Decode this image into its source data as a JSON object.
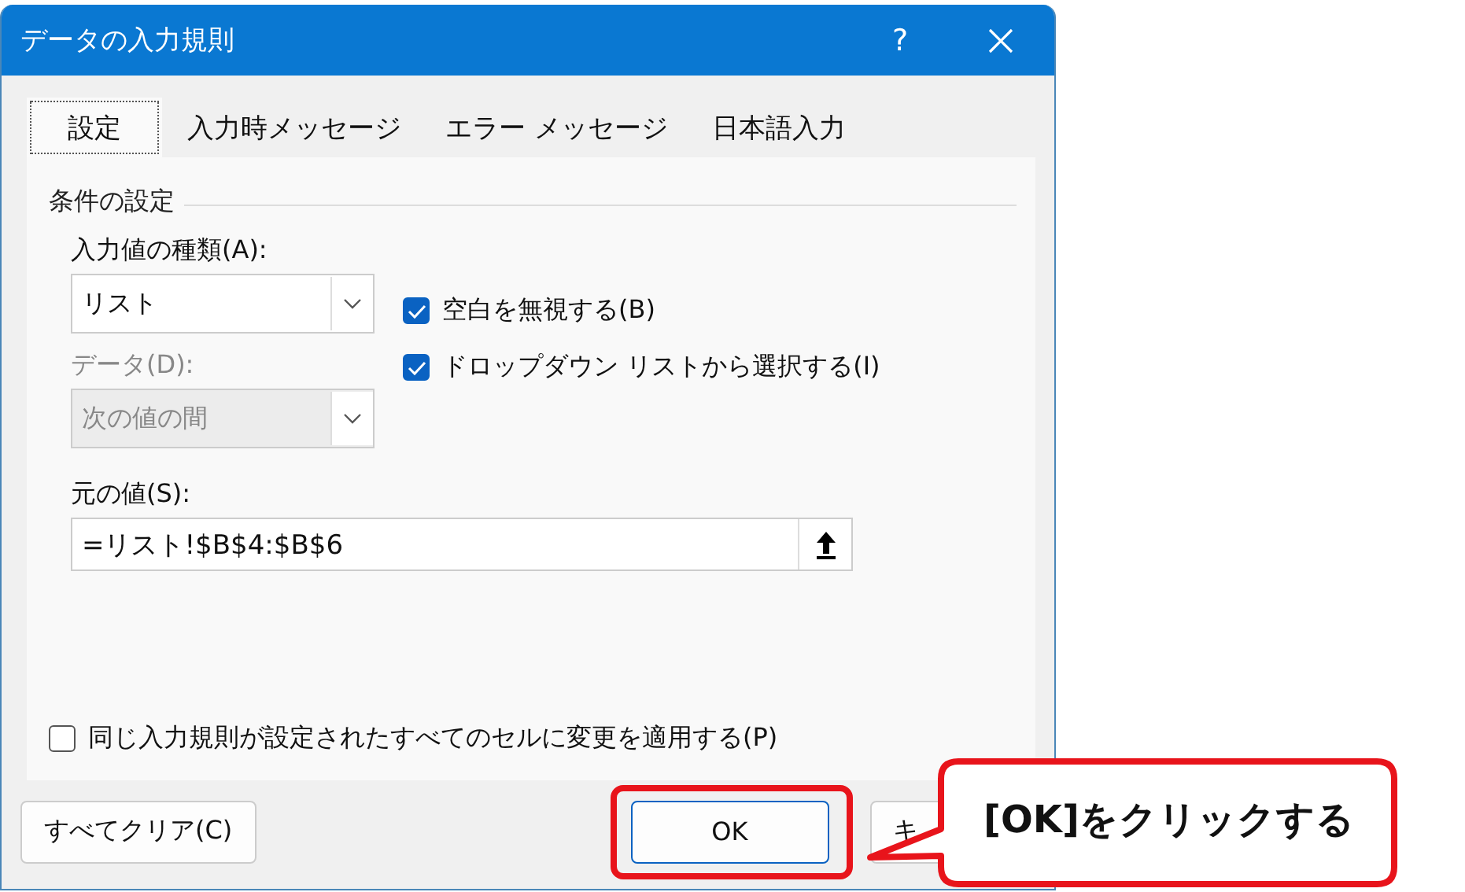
{
  "window": {
    "title": "データの入力規則",
    "help": "?"
  },
  "tabs": [
    {
      "label": "設定",
      "selected": true
    },
    {
      "label": "入力時メッセージ",
      "selected": false
    },
    {
      "label": "エラー メッセージ",
      "selected": false
    },
    {
      "label": "日本語入力",
      "selected": false
    }
  ],
  "section": {
    "title": "条件の設定"
  },
  "allow": {
    "label": "入力値の種類(A):",
    "value": "リスト",
    "disabled": false
  },
  "data": {
    "label": "データ(D):",
    "value": "次の値の間",
    "disabled": true
  },
  "checkboxes": [
    {
      "label": "空白を無視する(B)",
      "checked": true
    },
    {
      "label": "ドロップダウン リストから選択する(I)",
      "checked": true
    }
  ],
  "source": {
    "label": "元の値(S):",
    "value": "=リスト!$B$4:$B$6"
  },
  "apply_all": {
    "label": "同じ入力規則が設定されたすべてのセルに変更を適用する(P)",
    "checked": false
  },
  "buttons": [
    {
      "label": "すべてクリア(C)",
      "highlighted": false
    },
    {
      "label": "OK",
      "highlighted": true
    },
    {
      "label": "キ",
      "highlighted": false
    }
  ],
  "callout": {
    "text": "[OK]をクリックする"
  }
}
